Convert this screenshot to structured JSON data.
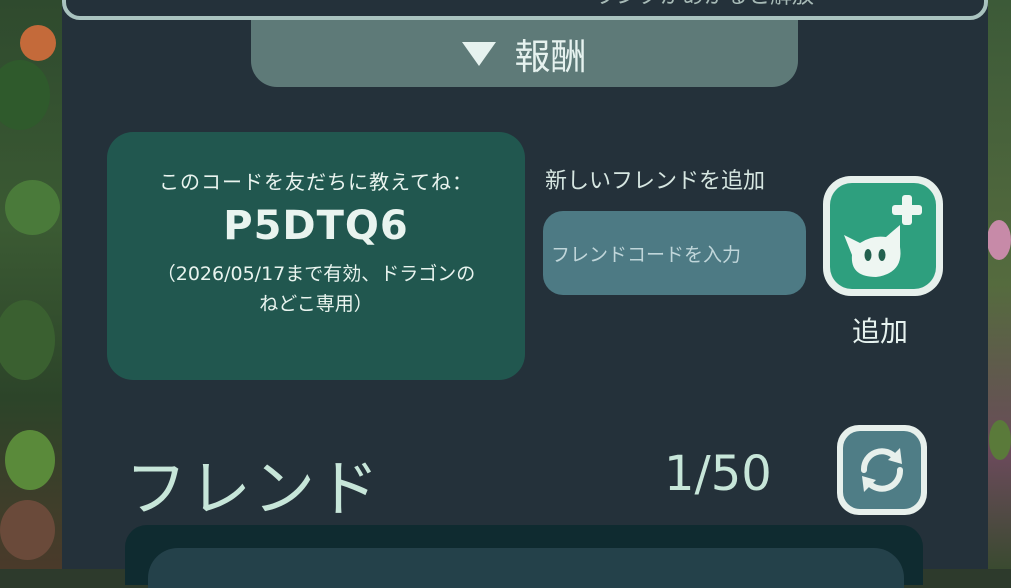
{
  "top_box": {
    "text": "ランクがあがると解放"
  },
  "reward_tab": {
    "label": "報酬"
  },
  "friend_code_card": {
    "hint": "このコードを友だちに教えてね：",
    "code": "P5DTQ6",
    "note": "（2026/05/17まで有効、ドラゴンのねどこ専用）"
  },
  "add_friend": {
    "title": "新しいフレンドを追加",
    "input_placeholder": "フレンドコードを入力",
    "button_label": "追加"
  },
  "friends": {
    "title": "フレンド",
    "count": "1/50"
  },
  "colors": {
    "panel": "#24313a",
    "accent_green": "#2e9f7e",
    "card": "#21574f",
    "input": "#4d7a84",
    "text_light": "#e6f2ef"
  },
  "icons": {
    "reward_toggle": "triangle-down-icon",
    "add_friend": "cat-plus-icon",
    "refresh": "refresh-icon"
  }
}
